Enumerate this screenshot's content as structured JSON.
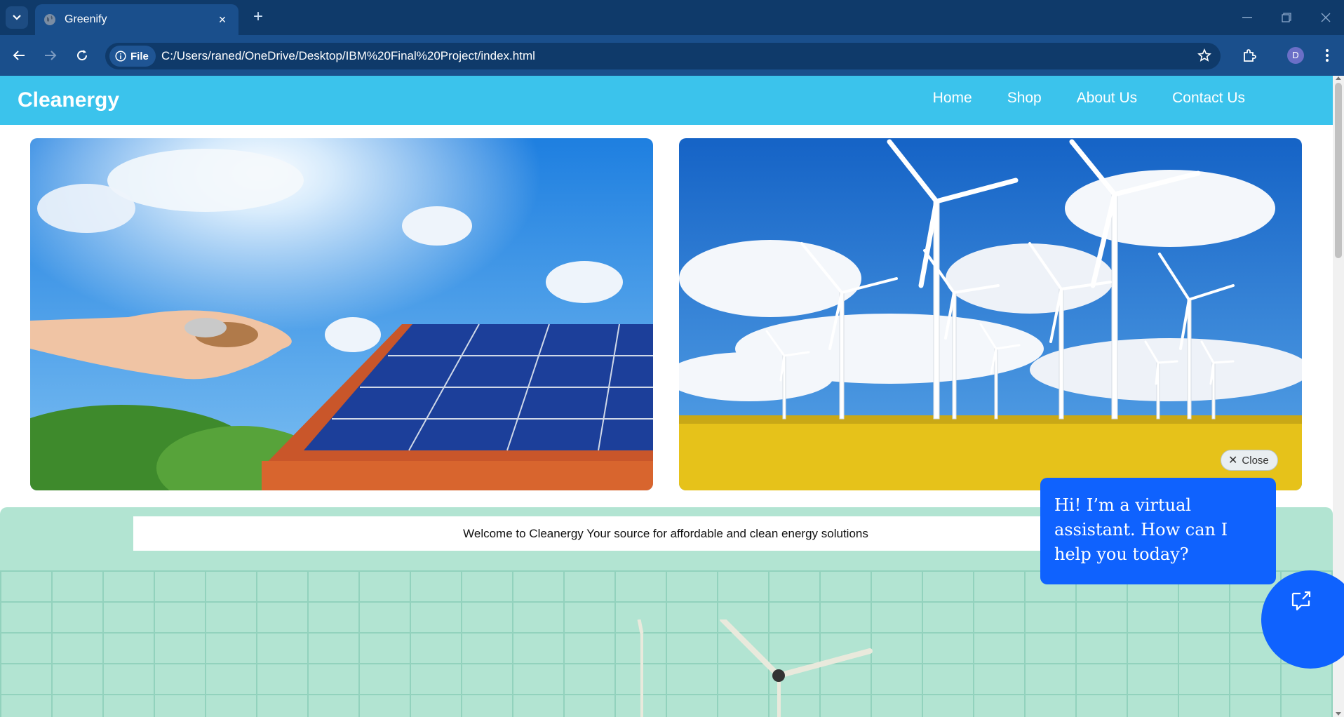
{
  "browser": {
    "tab_title": "Greenify",
    "tab_close": "×",
    "new_tab": "+",
    "security_chip": "File",
    "url": "C:/Users/raned/OneDrive/Desktop/IBM%20Final%20Project/index.html",
    "profile_initial": "D"
  },
  "site": {
    "brand": "Cleanergy",
    "nav": [
      "Home",
      "Shop",
      "About Us",
      "Contact Us"
    ],
    "welcome_text": "Welcome to Cleanergy Your source for affordable and clean energy solutions"
  },
  "chat": {
    "close_label": "Close",
    "close_glyph": "✕",
    "message": "Hi! I’m a virtual assistant. How can I help you today?"
  },
  "icons": [
    "chevron-down-icon",
    "globe-icon",
    "close-icon",
    "back-icon",
    "forward-icon",
    "reload-icon",
    "info-icon",
    "star-icon",
    "extensions-icon",
    "kebab-menu-icon",
    "chat-icon"
  ],
  "colors": {
    "header": "#3bc3ec",
    "chrome_dark": "#0f3a6a",
    "chrome_toolbar": "#1a4f8c",
    "chat_blue": "#0f62fe",
    "green_section": "#b2e4d2"
  }
}
